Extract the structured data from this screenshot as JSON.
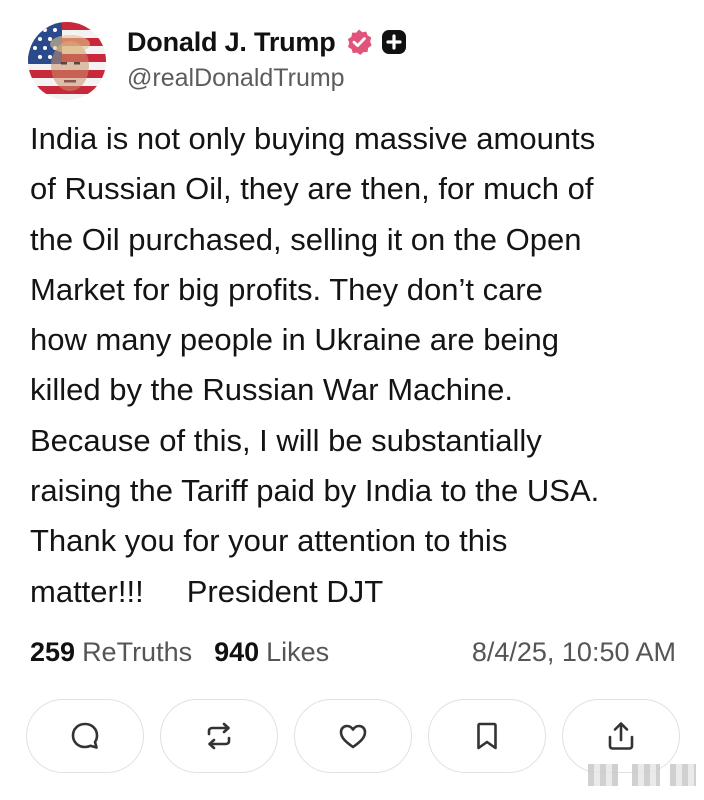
{
  "author": {
    "display_name": "Donald J. Trump",
    "handle": "@realDonaldTrump",
    "avatar_icon": "flag-portrait-avatar",
    "verified_icon": "verified-badge-icon",
    "plus_icon": "plus-badge-icon",
    "verified_color": "#e0547a"
  },
  "post": {
    "lines": [
      "India is not only buying massive amounts",
      "of Russian Oil, they are then, for much of",
      "the Oil purchased, selling it on the Open",
      "Market for big profits. They don’t care",
      "how many people in Ukraine are being",
      "killed by the Russian War Machine.",
      "Because of this, I will be substantially",
      "raising the Tariff paid by India to the USA.",
      "Thank you for your attention to this",
      "matter!!!     President DJT"
    ]
  },
  "stats": {
    "retruths_count": "259",
    "retruths_label": "ReTruths",
    "likes_count": "940",
    "likes_label": "Likes",
    "timestamp": "8/4/25, 10:50 AM"
  },
  "actions": [
    {
      "name": "reply",
      "icon": "comment-icon"
    },
    {
      "name": "retruth",
      "icon": "repost-icon"
    },
    {
      "name": "like",
      "icon": "heart-icon"
    },
    {
      "name": "bookmark",
      "icon": "bookmark-icon"
    },
    {
      "name": "share",
      "icon": "share-icon"
    }
  ]
}
